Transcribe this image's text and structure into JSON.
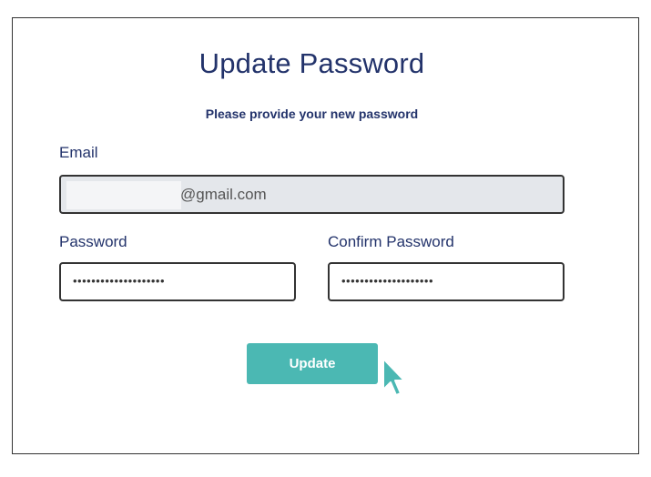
{
  "form": {
    "title": "Update Password",
    "subtitle": "Please provide your new password",
    "email_label": "Email",
    "email_value_visible": "@gmail.com",
    "password_label": "Password",
    "password_value": "••••••••••••••••••••",
    "confirm_label": "Confirm Password",
    "confirm_value": "••••••••••••••••••••",
    "submit_label": "Update"
  },
  "colors": {
    "heading": "#23336b",
    "accent": "#4bb8b3",
    "readonly_bg": "#e4e7eb",
    "border": "#333333"
  },
  "icons": {
    "cursor": "mouse-pointer-icon"
  }
}
